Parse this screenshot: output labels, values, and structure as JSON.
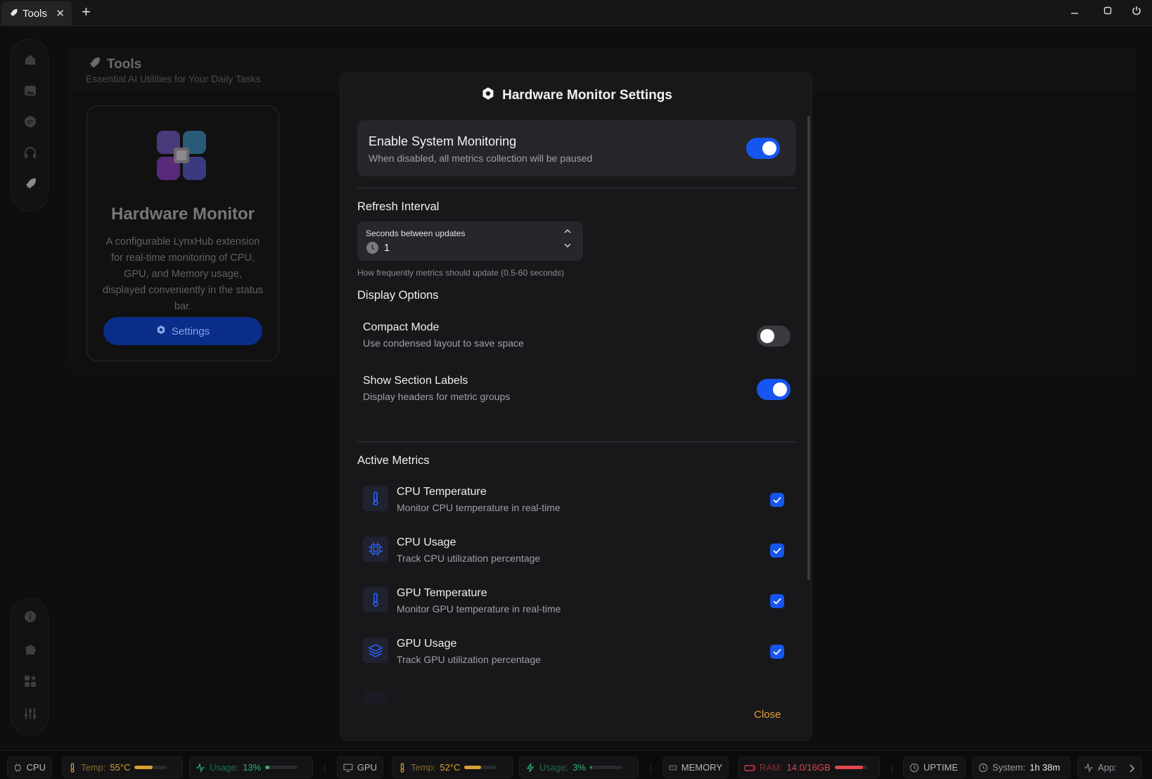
{
  "window": {
    "tab_label": "Tools",
    "tab_close": "✕",
    "new_tab": "+"
  },
  "page": {
    "title": "Tools",
    "subtitle": "Essential AI Utilities for Your Daily Tasks"
  },
  "tool_card": {
    "title": "Hardware Monitor",
    "description": "A configurable LynxHub extension for real-time monitoring of CPU, GPU, and Memory usage, displayed conveniently in the status bar.",
    "button_label": "Settings"
  },
  "modal": {
    "title": "Hardware Monitor Settings",
    "enable": {
      "title": "Enable System Monitoring",
      "subtitle": "When disabled, all metrics collection will be paused",
      "on": true
    },
    "refresh": {
      "section_label": "Refresh Interval",
      "field_label": "Seconds between updates",
      "value": "1",
      "help": "How frequently metrics should update (0.5-60 seconds)"
    },
    "display": {
      "section_label": "Display Options",
      "compact": {
        "title": "Compact Mode",
        "subtitle": "Use condensed layout to save space",
        "on": false
      },
      "labels": {
        "title": "Show Section Labels",
        "subtitle": "Display headers for metric groups",
        "on": true
      }
    },
    "metrics": {
      "section_label": "Active Metrics",
      "items": [
        {
          "title": "CPU Temperature",
          "subtitle": "Monitor CPU temperature in real-time",
          "icon": "thermometer-icon",
          "checked": true
        },
        {
          "title": "CPU Usage",
          "subtitle": "Track CPU utilization percentage",
          "icon": "cpu-chip-icon",
          "checked": true
        },
        {
          "title": "GPU Temperature",
          "subtitle": "Monitor GPU temperature in real-time",
          "icon": "thermometer-icon",
          "checked": true
        },
        {
          "title": "GPU Usage",
          "subtitle": "Track GPU utilization percentage",
          "icon": "layers-icon",
          "checked": true
        }
      ]
    },
    "close_label": "Close"
  },
  "statusbar": {
    "cpu": {
      "label": "CPU",
      "temp_label": "Temp:",
      "temp_value": "55°C",
      "temp_level": 0.55,
      "usage_label": "Usage:",
      "usage_value": "13%",
      "usage_level": 0.13
    },
    "gpu": {
      "label": "GPU",
      "temp_label": "Temp:",
      "temp_value": "52°C",
      "temp_level": 0.52,
      "usage_label": "Usage:",
      "usage_value": "3%",
      "usage_level": 0.03
    },
    "memory": {
      "label": "MEMORY",
      "ram_label": "RAM:",
      "ram_value": "14.0/16GB",
      "ram_level": 0.875
    },
    "uptime": {
      "label": "UPTIME",
      "system_label": "System:",
      "system_value": "1h 38m",
      "app_label": "App:"
    }
  },
  "colors": {
    "accent": "#1556f0",
    "temp": "#d6a030",
    "usage": "#2fb36f",
    "ram": "#e0474c",
    "close": "#e6a23c"
  }
}
